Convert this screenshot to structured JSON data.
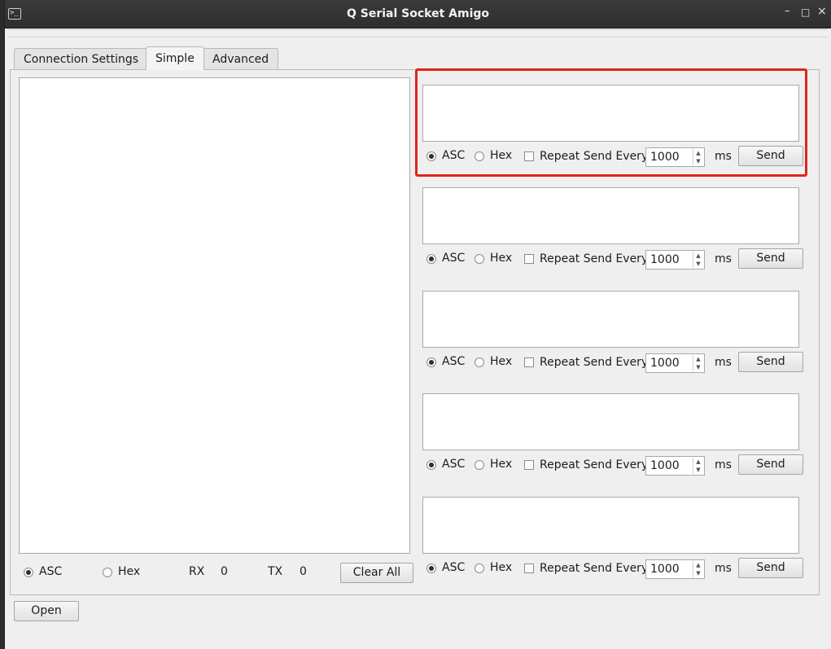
{
  "window": {
    "title": "Q Serial Socket Amigo",
    "app_icon_glyph": ">_",
    "controls": {
      "minimize": "–",
      "maximize": "□",
      "close": "×"
    }
  },
  "tabs": [
    {
      "label": "Connection Settings",
      "active": false
    },
    {
      "label": "Simple",
      "active": true
    },
    {
      "label": "Advanced",
      "active": false
    }
  ],
  "receive": {
    "mode_asc_label": "ASC",
    "mode_hex_label": "Hex",
    "selected_mode": "ASC",
    "rx_label": "RX",
    "rx_value": "0",
    "tx_label": "TX",
    "tx_value": "0",
    "clear_label": "Clear All"
  },
  "send_blocks": [
    {
      "text": "",
      "asc_label": "ASC",
      "hex_label": "Hex",
      "selected_mode": "ASC",
      "repeat_checked": false,
      "repeat_label": "Repeat Send Every",
      "interval": "1000",
      "unit": "ms",
      "send_label": "Send"
    },
    {
      "text": "",
      "asc_label": "ASC",
      "hex_label": "Hex",
      "selected_mode": "ASC",
      "repeat_checked": false,
      "repeat_label": "Repeat Send Every",
      "interval": "1000",
      "unit": "ms",
      "send_label": "Send"
    },
    {
      "text": "",
      "asc_label": "ASC",
      "hex_label": "Hex",
      "selected_mode": "ASC",
      "repeat_checked": false,
      "repeat_label": "Repeat Send Every",
      "interval": "1000",
      "unit": "ms",
      "send_label": "Send"
    },
    {
      "text": "",
      "asc_label": "ASC",
      "hex_label": "Hex",
      "selected_mode": "ASC",
      "repeat_checked": false,
      "repeat_label": "Repeat Send Every",
      "interval": "1000",
      "unit": "ms",
      "send_label": "Send"
    },
    {
      "text": "",
      "asc_label": "ASC",
      "hex_label": "Hex",
      "selected_mode": "ASC",
      "repeat_checked": false,
      "repeat_label": "Repeat Send Every",
      "interval": "1000",
      "unit": "ms",
      "send_label": "Send"
    }
  ],
  "footer": {
    "open_label": "Open"
  },
  "colors": {
    "highlight": "#e0251b",
    "titlebar": "#2e2e2e",
    "window_bg": "#efefef"
  }
}
